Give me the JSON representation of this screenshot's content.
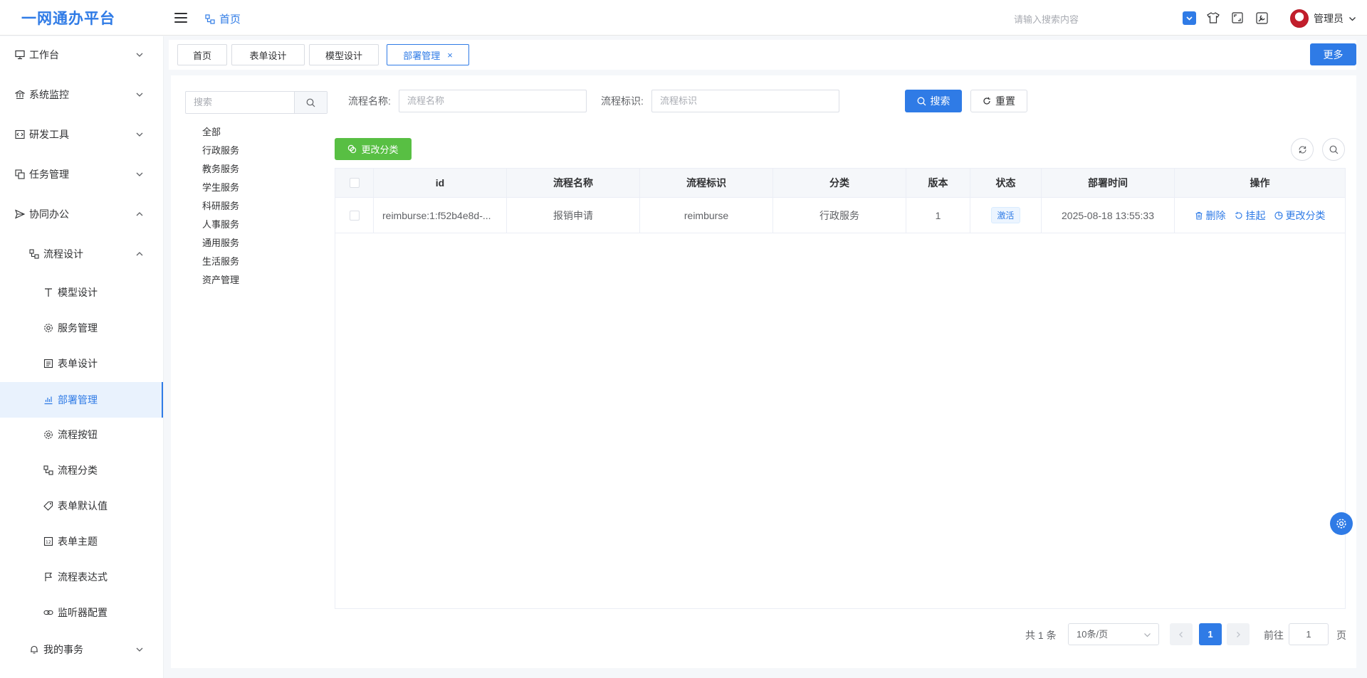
{
  "app": {
    "title": "一网通办平台"
  },
  "header": {
    "breadcrumb": "首页",
    "search_placeholder": "请输入搜索内容",
    "user_name": "管理员",
    "icons": [
      "checkbox-icon",
      "theme-shirt-icon",
      "fullscreen-icon",
      "settings-screen-icon"
    ]
  },
  "sidebar": {
    "items": [
      {
        "label": "工作台",
        "icon": "monitor-icon",
        "expanded": false
      },
      {
        "label": "系统监控",
        "icon": "bank-icon",
        "expanded": false
      },
      {
        "label": "研发工具",
        "icon": "code-icon",
        "expanded": false
      },
      {
        "label": "任务管理",
        "icon": "copy-icon",
        "expanded": false
      },
      {
        "label": "协同办公",
        "icon": "send-icon",
        "expanded": true
      },
      {
        "label": "流程设计",
        "icon": "flow-icon",
        "expanded": true
      },
      {
        "label": "模型设计",
        "icon": "text-icon"
      },
      {
        "label": "服务管理",
        "icon": "gear-icon"
      },
      {
        "label": "表单设计",
        "icon": "form-icon"
      },
      {
        "label": "部署管理",
        "icon": "chart-icon",
        "active": true
      },
      {
        "label": "流程按钮",
        "icon": "gear-icon"
      },
      {
        "label": "流程分类",
        "icon": "flow-icon"
      },
      {
        "label": "表单默认值",
        "icon": "tag-icon"
      },
      {
        "label": "表单主题",
        "icon": "number-icon"
      },
      {
        "label": "流程表达式",
        "icon": "flag-icon"
      },
      {
        "label": "监听器配置",
        "icon": "link-icon"
      },
      {
        "label": "我的事务",
        "icon": "bell-icon",
        "expanded": false
      }
    ]
  },
  "tabs": [
    {
      "label": "首页"
    },
    {
      "label": "表单设计"
    },
    {
      "label": "模型设计"
    },
    {
      "label": "部署管理",
      "active": true,
      "close": "×"
    }
  ],
  "more_button": "更多",
  "tree": {
    "search_placeholder": "搜索",
    "nodes": [
      "全部",
      "行政服务",
      "教务服务",
      "学生服务",
      "科研服务",
      "人事服务",
      "通用服务",
      "生活服务",
      "资产管理"
    ]
  },
  "filters": {
    "name_label": "流程名称:",
    "name_placeholder": "流程名称",
    "key_label": "流程标识:",
    "key_placeholder": "流程标识",
    "search_button": "搜索",
    "reset_button": "重置"
  },
  "toolbar": {
    "change_category": "更改分类"
  },
  "table": {
    "columns": [
      "id",
      "流程名称",
      "流程标识",
      "分类",
      "版本",
      "状态",
      "部署时间",
      "操作"
    ],
    "rows": [
      {
        "id": "reimburse:1:f52b4e8d-...",
        "name": "报销申请",
        "key": "reimburse",
        "category": "行政服务",
        "version": "1",
        "status": "激活",
        "deploy_time": "2025-08-18 13:55:33",
        "ops": [
          "删除",
          "挂起",
          "更改分类"
        ]
      }
    ]
  },
  "pagination": {
    "total": "共 1 条",
    "page_size": "10条/页",
    "current_page": "1",
    "goto_label": "前往",
    "goto_value": "1",
    "page_suffix": "页"
  },
  "colors": {
    "primary": "#2f7be6",
    "success": "#58bf43",
    "active_bg": "#e9f2fd"
  }
}
